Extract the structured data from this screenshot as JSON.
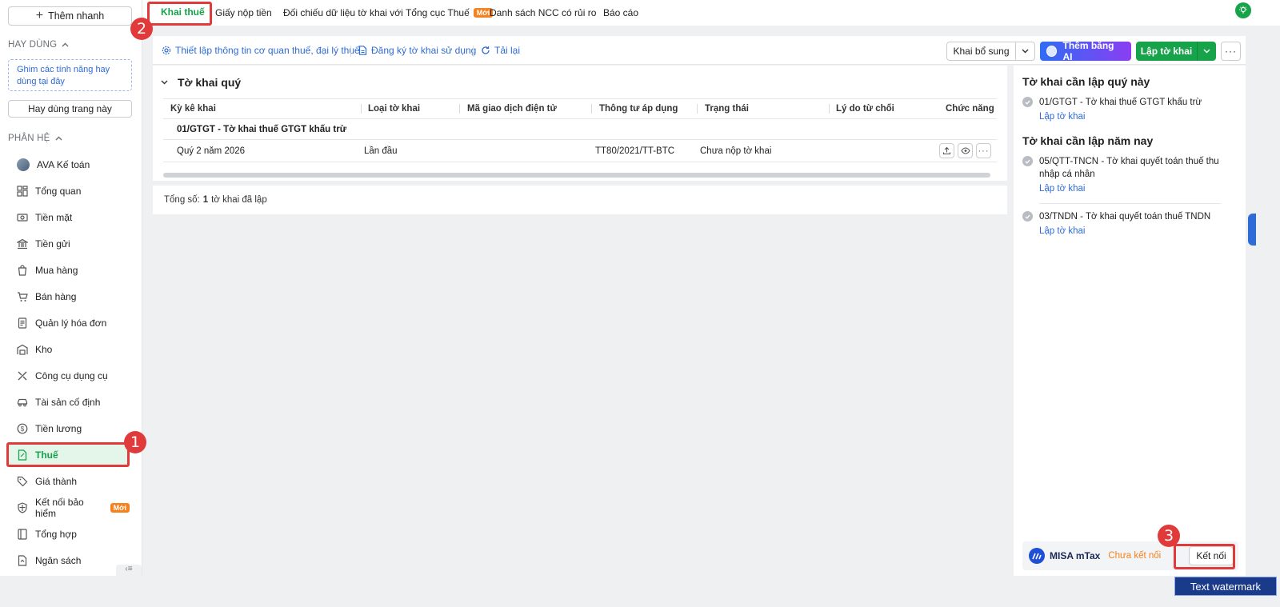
{
  "sidebar": {
    "quick_add": "Thêm nhanh",
    "frequent_title": "HAY DÙNG",
    "pin_hint": "Ghim các tính năng hay dùng tại đây",
    "use_page": "Hay dùng trang này",
    "modules_title": "PHÂN HỆ",
    "items": [
      {
        "label": "AVA Kế toán"
      },
      {
        "label": "Tổng quan"
      },
      {
        "label": "Tiền mặt"
      },
      {
        "label": "Tiền gửi"
      },
      {
        "label": "Mua hàng"
      },
      {
        "label": "Bán hàng"
      },
      {
        "label": "Quản lý hóa đơn"
      },
      {
        "label": "Kho"
      },
      {
        "label": "Công cụ dụng cụ"
      },
      {
        "label": "Tài sản cố định"
      },
      {
        "label": "Tiền lương"
      },
      {
        "label": "Thuế"
      },
      {
        "label": "Giá thành"
      },
      {
        "label": "Kết nối bảo hiểm",
        "badge": "Mới"
      },
      {
        "label": "Tổng hợp"
      },
      {
        "label": "Ngân sách"
      }
    ],
    "active_item": "Thuế"
  },
  "tabs": [
    {
      "label": "Khai thuế"
    },
    {
      "label": "Giấy nộp tiền"
    },
    {
      "label": "Đối chiếu dữ liệu tờ khai với Tổng cục Thuế",
      "badge": "Mới"
    },
    {
      "label": "Danh sách NCC có rủi ro"
    },
    {
      "label": "Báo cáo"
    }
  ],
  "toolbar": {
    "setup_link": "Thiết lập thông tin cơ quan thuế, đại lý thuế",
    "register_link": "Đăng ký tờ khai sử dụng",
    "reload_link": "Tải lại",
    "supplement_btn": "Khai bổ sung",
    "ai_btn": "Thêm bằng AI",
    "create_btn": "Lập tờ khai"
  },
  "table": {
    "group_title": "Tờ khai quý",
    "columns": [
      "Kỳ kê khai",
      "Loại tờ khai",
      "Mã giao dịch điện tử",
      "Thông tư áp dụng",
      "Trạng thái",
      "Lý do từ chối",
      "Chức năng"
    ],
    "group_row": "01/GTGT - Tờ khai thuế GTGT khấu trừ",
    "rows": [
      {
        "period": "Quý 2 năm 2026",
        "type": "Lần đầu",
        "transaction_code": "",
        "circular": "TT80/2021/TT-BTC",
        "status": "Chưa nộp tờ khai",
        "reject_reason": ""
      }
    ]
  },
  "total": {
    "prefix": "Tổng số:",
    "count": "1",
    "suffix": "tờ khai đã lập"
  },
  "right_panel": {
    "quarter_title": "Tờ khai cần lập quý này",
    "quarter_items": [
      {
        "code": "01/GTGT",
        "name": "Tờ khai thuế GTGT khấu trừ",
        "link": "Lập tờ khai"
      }
    ],
    "year_title": "Tờ khai cần lập năm nay",
    "year_items": [
      {
        "code": "05/QTT-TNCN",
        "name": "Tờ khai quyết toán thuế thu nhập cá nhân",
        "link": "Lập tờ khai"
      },
      {
        "code": "03/TNDN",
        "name": "Tờ khai quyết toán thuế TNDN",
        "link": "Lập tờ khai"
      }
    ],
    "mtax": {
      "name": "MISA mTax",
      "status": "Chưa kết nối",
      "connect": "Kết nối"
    }
  },
  "annotations": {
    "step1": "1",
    "step2": "2",
    "step3": "3"
  },
  "watermark": "Text watermark",
  "colors": {
    "accent_green": "#15a34a",
    "link_blue": "#2e6bd6",
    "annotation_red": "#e03a3a",
    "badge_orange": "#f5821f"
  }
}
